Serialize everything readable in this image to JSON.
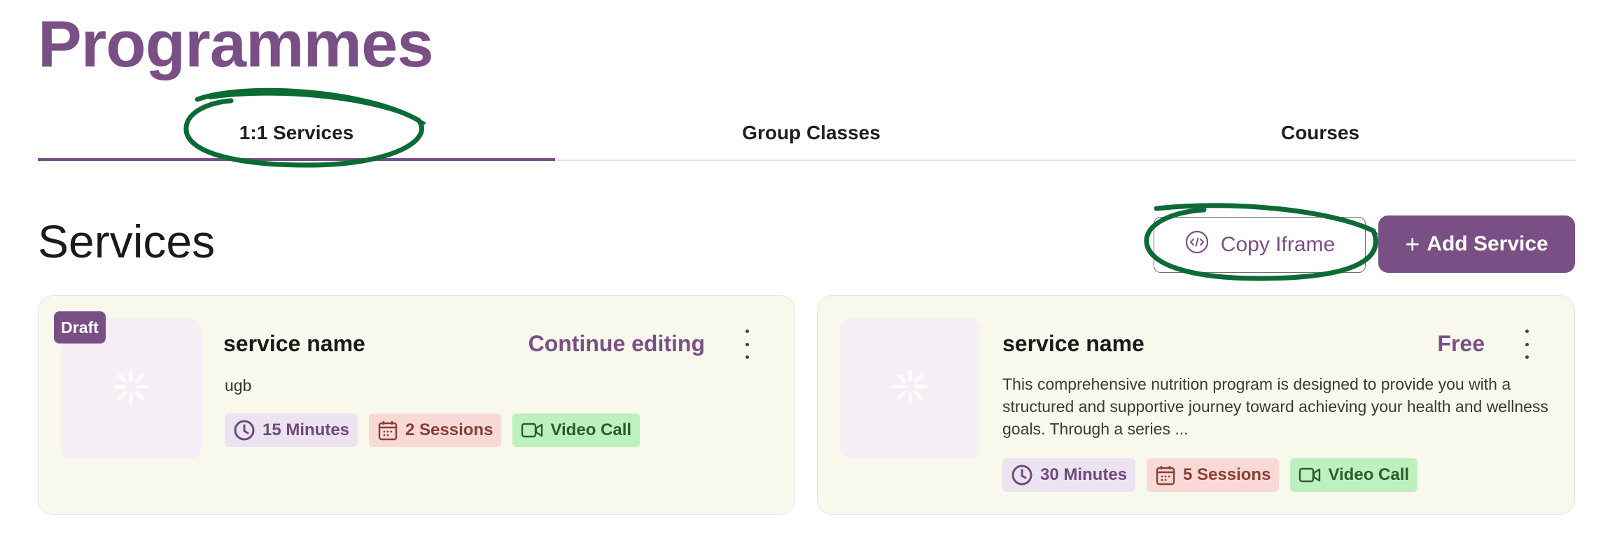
{
  "header": {
    "title": "Programmes"
  },
  "tabs": [
    {
      "label": "1:1 Services",
      "active": true
    },
    {
      "label": "Group Classes",
      "active": false
    },
    {
      "label": "Courses",
      "active": false
    }
  ],
  "services": {
    "title": "Services",
    "copy_iframe_label": "Copy Iframe",
    "add_service_label": "Add Service",
    "add_service_prefix": "+"
  },
  "cards": [
    {
      "badge": "Draft",
      "name": "service name",
      "action": "Continue editing",
      "description": "ugb",
      "chips": {
        "duration": "15 Minutes",
        "sessions": "2 Sessions",
        "call": "Video Call"
      }
    },
    {
      "name": "service name",
      "action": "Free",
      "description": "This comprehensive nutrition program is designed to provide you with a structured and supportive journey toward achieving your health and wellness goals. Through a series ...",
      "chips": {
        "duration": "30 Minutes",
        "sessions": "5 Sessions",
        "call": "Video Call"
      }
    }
  ],
  "colors": {
    "brand": "#7a4f86",
    "card_bg": "#f9f8ed",
    "thumb_bg": "#f5eef5",
    "chip_duration_bg": "#ece3f1",
    "chip_sessions_bg": "#f9d9d5",
    "chip_call_bg": "#bdf0bf"
  },
  "icons": {
    "copy_iframe": "code-icon",
    "thumbnail": "sparkle-placeholder-icon",
    "duration": "clock-icon",
    "sessions": "calendar-icon",
    "call": "video-camera-icon",
    "menu": "kebab-menu-icon"
  }
}
